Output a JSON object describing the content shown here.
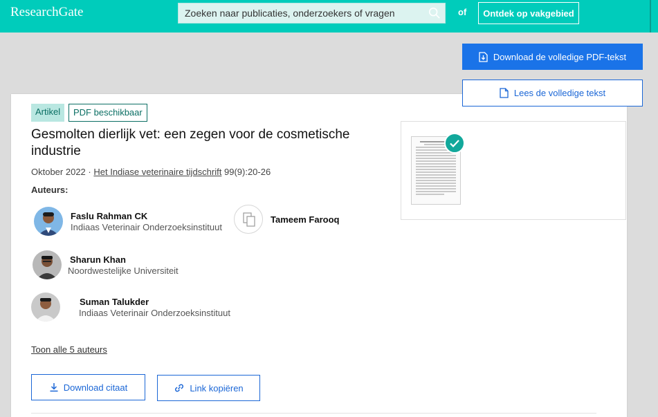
{
  "header": {
    "logo": "ResearchGate",
    "search_placeholder": "Zoeken naar publicaties, onderzoekers of vragen",
    "or_label": "of",
    "discover_label": "Ontdek op vakgebied"
  },
  "article": {
    "type_badge": "Artikel",
    "pdf_badge": "PDF beschikbaar",
    "title": "Gesmolten dierlijk vet: een zegen voor de cosmetische industrie",
    "date": "Oktober 2022",
    "separator": "·",
    "journal": "Het Indiase veterinaire tijdschrift",
    "volume": "99(9):20-26",
    "authors_label": "Auteurs:",
    "authors": [
      {
        "name": "Faslu Rahman CK",
        "affiliation": "Indiaas Veterinair Onderzoeksinstituut"
      },
      {
        "name": "Tameem Farooq",
        "affiliation": ""
      },
      {
        "name": "Sharun Khan",
        "affiliation": "Noordwestelijke Universiteit"
      },
      {
        "name": "Suman Talukder",
        "affiliation": "Indiaas Veterinair Onderzoeksinstituut"
      }
    ],
    "show_all_authors": "Toon alle 5 auteurs",
    "download_citation": "Download citaat",
    "copy_link": "Link kopiëren"
  },
  "pdf_panel": {
    "download_label": "Download de volledige PDF-tekst",
    "read_label": "Lees de volledige tekst"
  },
  "colors": {
    "brand": "#00ccbb",
    "primary_blue": "#1a73e8",
    "badge_bg": "#b9e7e1"
  }
}
